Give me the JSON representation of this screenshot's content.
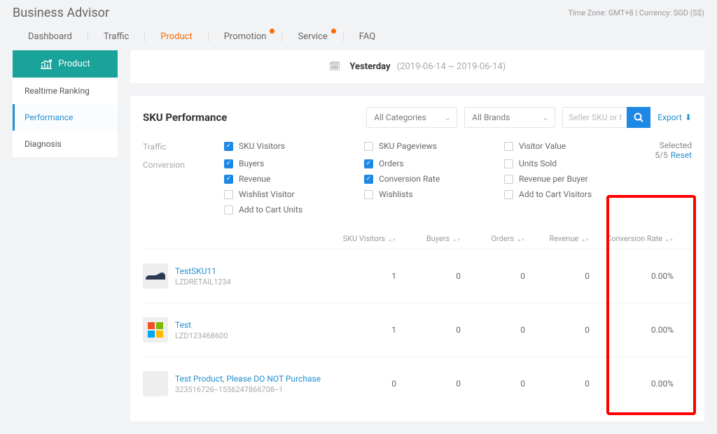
{
  "header": {
    "title": "Business Advisor",
    "tz": "Time Zone: GMT+8 | Currency: SGD (S$)"
  },
  "nav": {
    "dashboard": "Dashboard",
    "traffic": "Traffic",
    "product": "Product",
    "promotion": "Promotion",
    "service": "Service",
    "faq": "FAQ"
  },
  "sidebar": {
    "active_head": "Product",
    "items": [
      "Realtime Ranking",
      "Performance",
      "Diagnosis"
    ]
  },
  "datebar": {
    "label": "Yesterday",
    "range": "(2019-06-14 ~ 2019-06-14)"
  },
  "panel": {
    "title": "SKU Performance",
    "category": "All Categories",
    "brand": "All Brands",
    "search_ph": "Seller SKU or Name",
    "export": "Export",
    "selected": "Selected 5/5",
    "reset": "Reset"
  },
  "metrics": {
    "group_traffic": "Traffic",
    "group_conversion": "Conversion",
    "traffic": [
      {
        "label": "SKU Visitors",
        "checked": true
      },
      {
        "label": "SKU Pageviews",
        "checked": false
      },
      {
        "label": "Visitor Value",
        "checked": false
      }
    ],
    "conversion": [
      {
        "label": "Buyers",
        "checked": true
      },
      {
        "label": "Orders",
        "checked": true
      },
      {
        "label": "Units Sold",
        "checked": false
      },
      {
        "label": "Revenue",
        "checked": true
      },
      {
        "label": "Conversion Rate",
        "checked": true
      },
      {
        "label": "Revenue per Buyer",
        "checked": false
      },
      {
        "label": "Wishlist Visitor",
        "checked": false
      },
      {
        "label": "Wishlists",
        "checked": false
      },
      {
        "label": "Add to Cart Visitors",
        "checked": false
      },
      {
        "label": "Add to Cart Units",
        "checked": false
      }
    ]
  },
  "table": {
    "cols": [
      "SKU Visitors",
      "Buyers",
      "Orders",
      "Revenue",
      "Conversion Rate"
    ],
    "rows": [
      {
        "name": "TestSKU11",
        "sku": "LZDRETAIL1234",
        "v": [
          "1",
          "0",
          "0",
          "0",
          "0.00%"
        ],
        "thumb": "shoe"
      },
      {
        "name": "Test",
        "sku": "LZD123468600",
        "v": [
          "1",
          "0",
          "0",
          "0",
          "0.00%"
        ],
        "thumb": "logo"
      },
      {
        "name": "Test Product, Please DO NOT Purchase",
        "sku": "323516726--1556247866708--1",
        "v": [
          "0",
          "0",
          "0",
          "0",
          "0.00%"
        ],
        "thumb": "blank"
      }
    ]
  }
}
